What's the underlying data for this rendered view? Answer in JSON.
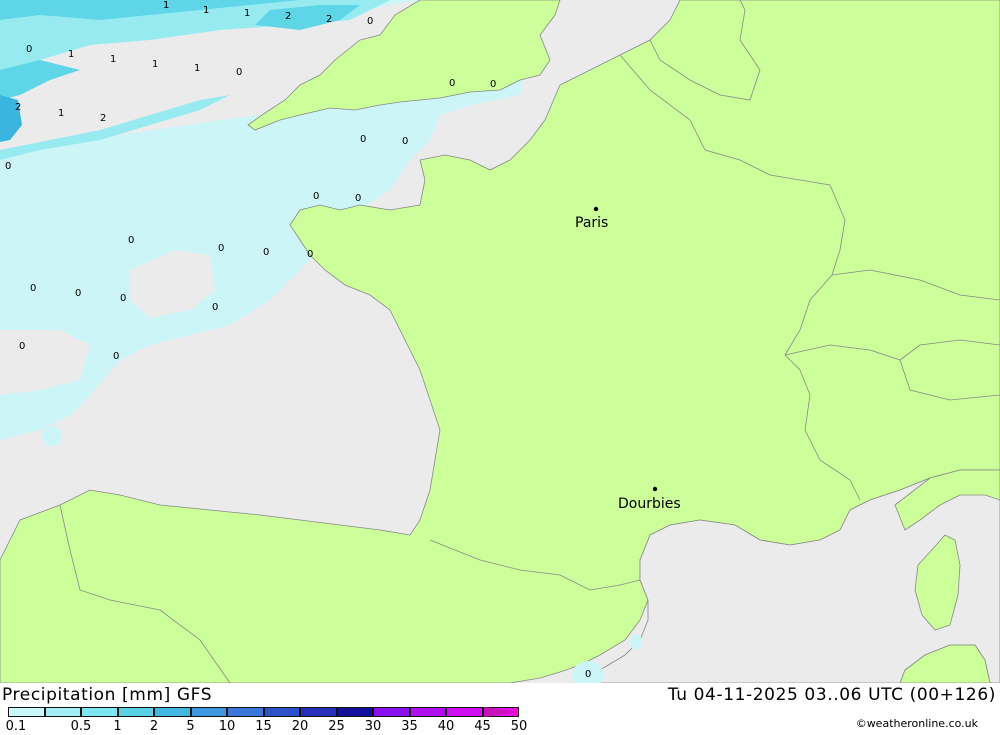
{
  "map": {
    "sea_color": "#ebebeb",
    "land_color": "#ccff99",
    "precip_colors": [
      "#ccf5f8",
      "#97ebf0",
      "#5fd6e8",
      "#3ab5e0"
    ],
    "cities": [
      {
        "name": "Paris"
      },
      {
        "name": "Dourbies"
      }
    ],
    "precip_values": [
      "1",
      "1",
      "1",
      "2",
      "2",
      "0",
      "0",
      "1",
      "1",
      "1",
      "1",
      "0",
      "2",
      "1",
      "2",
      "0",
      "0",
      "0",
      "0",
      "0",
      "0",
      "0",
      "0",
      "0",
      "0",
      "0",
      "0",
      "0",
      "0",
      "0",
      "0",
      "0",
      "0",
      "0",
      "0"
    ]
  },
  "footer": {
    "title": "Precipitation [mm] GFS",
    "timestamp": "Tu 04-11-2025 03..06 UTC (00+126)",
    "credit": "©weatheronline.co.uk"
  },
  "legend": {
    "colors": [
      "#c8f8fa",
      "#a5f0f4",
      "#7de6ee",
      "#5ad2e6",
      "#43b6e2",
      "#3c98e0",
      "#3a78da",
      "#2e52cc",
      "#2430b8",
      "#14129a",
      "#8a10ee",
      "#b010f0",
      "#d010f0",
      "#ee10e6",
      "#c810b8"
    ],
    "ticks": [
      "0.1",
      "0.5",
      "1",
      "2",
      "5",
      "10",
      "15",
      "20",
      "25",
      "30",
      "35",
      "40",
      "45",
      "50"
    ]
  }
}
